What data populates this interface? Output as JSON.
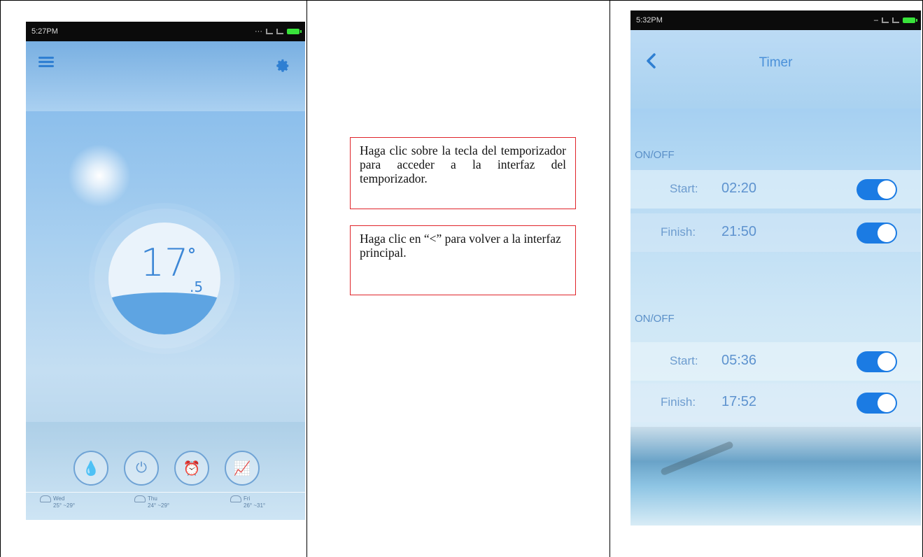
{
  "left_screen": {
    "status_time": "5:27PM",
    "temperature_main": "17",
    "temperature_decimal": ".5",
    "forecast": [
      {
        "day": "Wed",
        "range": "25° ~29°"
      },
      {
        "day": "Thu",
        "range": "24° ~29°"
      },
      {
        "day": "Fri",
        "range": "26° ~31°"
      }
    ],
    "icons": [
      "menu-icon",
      "gear-icon",
      "heat-mode-icon",
      "power-icon",
      "timer-icon",
      "chart-icon"
    ]
  },
  "notes": {
    "timer_hint": "Haga clic sobre la tecla del temporizador para acceder a la interfaz del temporizador.",
    "back_hint": "Haga clic en “<” para volver a la interfaz principal."
  },
  "timer_screen": {
    "status_time": "5:32PM",
    "title": "Timer",
    "groups": [
      {
        "label": "ON/OFF",
        "rows": [
          {
            "label": "Start:",
            "time": "02:20",
            "enabled": true
          },
          {
            "label": "Finish:",
            "time": "21:50",
            "enabled": true
          }
        ]
      },
      {
        "label": "ON/OFF",
        "rows": [
          {
            "label": "Start:",
            "time": "05:36",
            "enabled": true
          },
          {
            "label": "Finish:",
            "time": "17:52",
            "enabled": true
          }
        ]
      }
    ]
  },
  "colors": {
    "accent_blue": "#1b7be3",
    "note_border": "#e0242a"
  }
}
